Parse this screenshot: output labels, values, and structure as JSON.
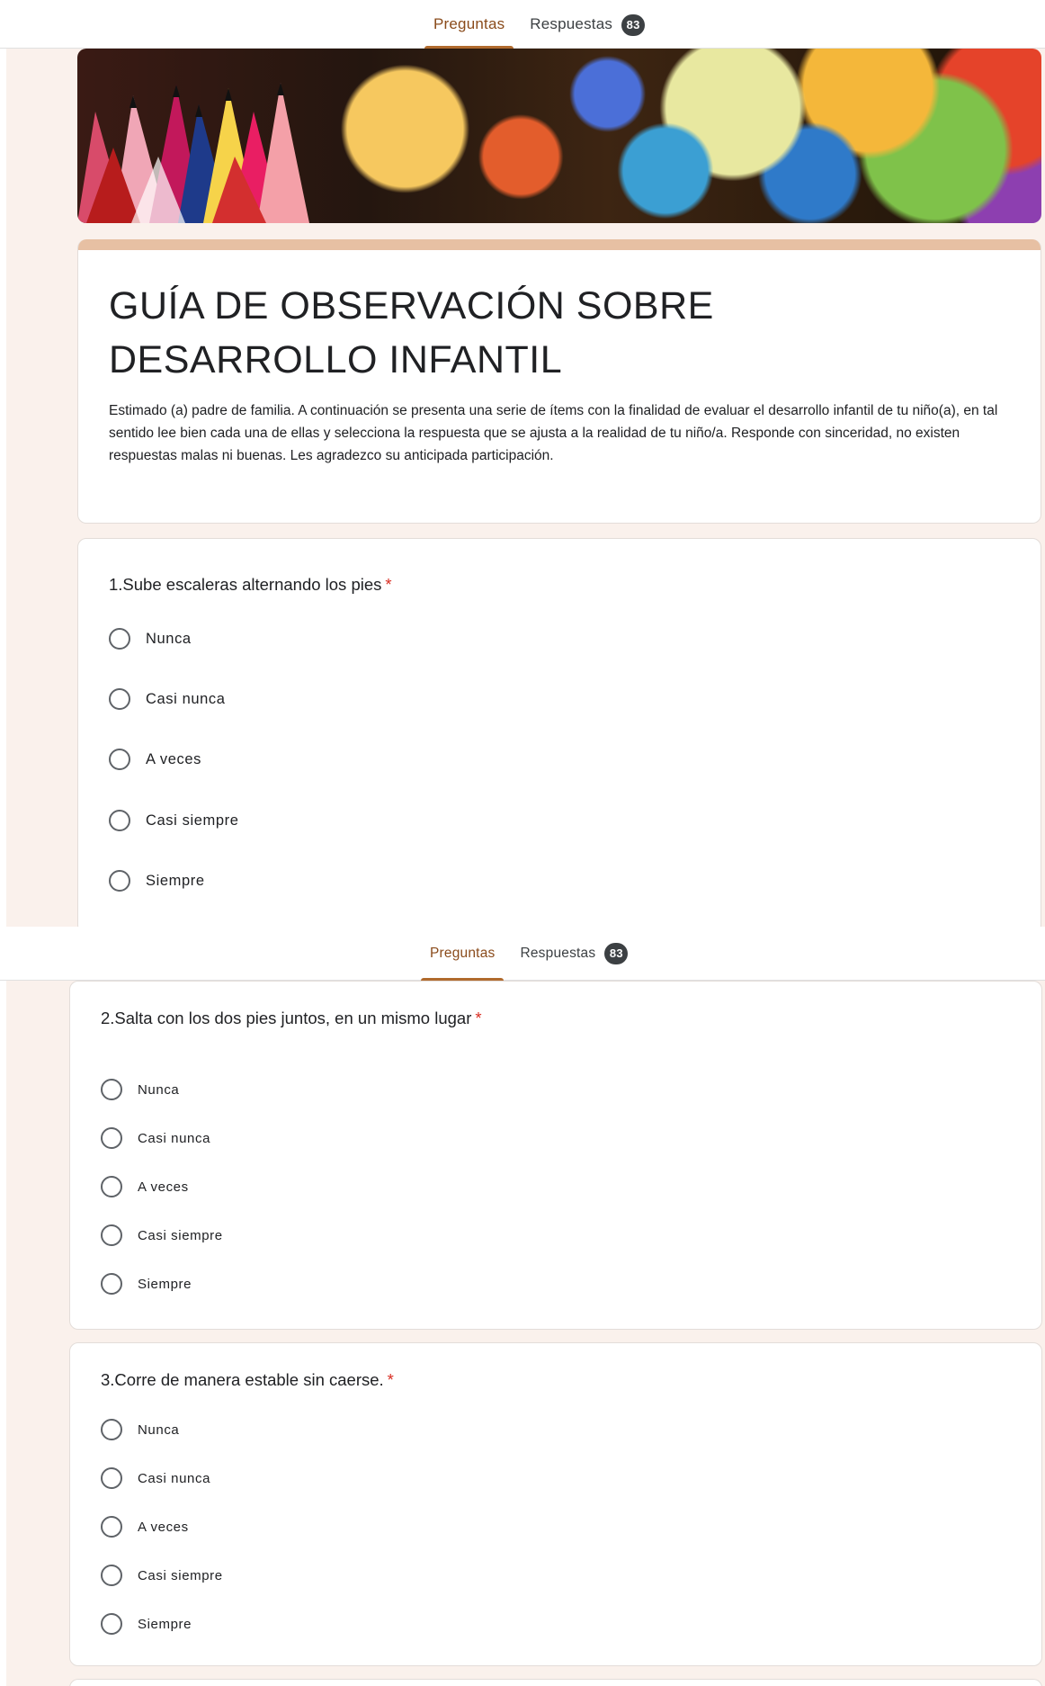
{
  "tabs": {
    "questions_label": "Preguntas",
    "responses_label": "Respuestas",
    "responses_count": "83"
  },
  "form": {
    "title": "GUÍA DE OBSERVACIÓN SOBRE DESARROLLO INFANTIL",
    "description": "Estimado (a) padre de familia. A continuación se presenta una serie de ítems con la finalidad de evaluar el desarrollo infantil de tu niño(a), en tal sentido lee bien cada una de ellas y selecciona la respuesta que se ajusta a la realidad de tu  niño/a. Responde con sinceridad, no existen respuestas malas ni buenas. Les agradezco su anticipada participación."
  },
  "questions": [
    {
      "title": "1.Sube  escaleras alternando los pies",
      "required_mark": "*",
      "options": [
        "Nunca",
        "Casi nunca",
        "A veces",
        "Casi siempre",
        "Siempre"
      ]
    },
    {
      "title": "2.Salta  con los dos pies juntos, en un mismo lugar",
      "required_mark": "*",
      "options": [
        "Nunca",
        "Casi nunca",
        "A veces",
        "Casi siempre",
        "Siempre"
      ]
    },
    {
      "title": "3.Corre de manera estable sin caerse.",
      "required_mark": "*",
      "options": [
        "Nunca",
        "Casi nunca",
        "A veces",
        "Casi siempre",
        "Siempre"
      ]
    }
  ],
  "colors": {
    "accent": "#b06a2d",
    "page_background": "#faf1ec",
    "title_strip": "#e7c0a3",
    "required": "#d93025"
  },
  "icons": {
    "radio": "radio-unchecked-icon"
  }
}
